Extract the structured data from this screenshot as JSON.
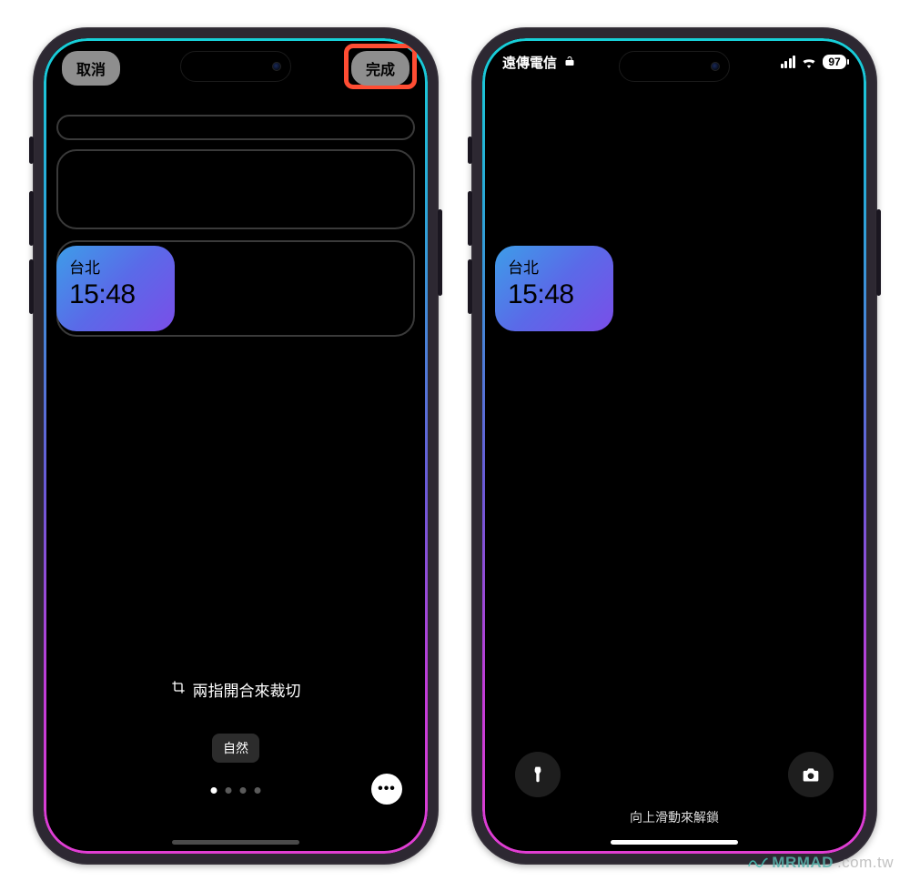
{
  "editor": {
    "cancel_label": "取消",
    "done_label": "完成",
    "crop_hint": "兩指開合來裁切",
    "filter_label": "自然",
    "more_label": "•••"
  },
  "widget": {
    "city": "台北",
    "time": "15:48"
  },
  "lockscreen": {
    "carrier": "遠傳電信",
    "battery_pct": "97",
    "swipe_hint": "向上滑動來解鎖"
  },
  "watermark": {
    "brand": "MRMAD",
    "tld": ".com.tw"
  }
}
